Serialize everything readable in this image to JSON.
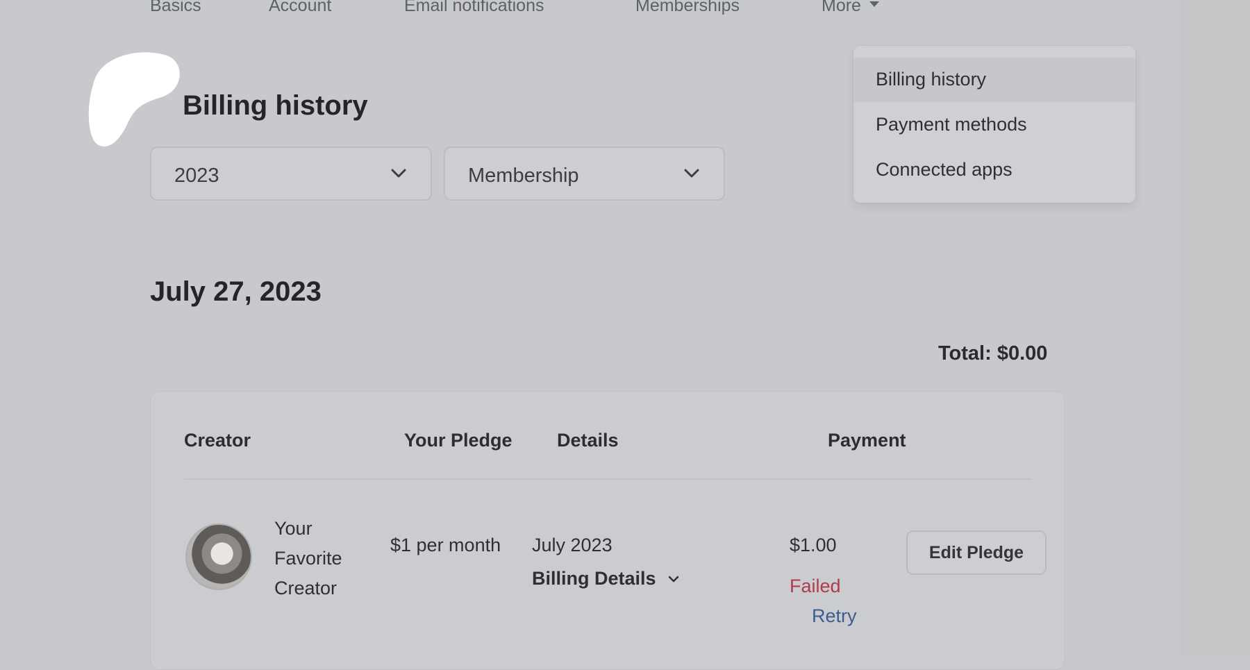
{
  "nav": {
    "tabs": [
      "Basics",
      "Account",
      "Email notifications",
      "Memberships"
    ],
    "more_label": "More"
  },
  "menu": {
    "items": [
      "Billing history",
      "Payment methods",
      "Connected apps"
    ],
    "active_index": 0
  },
  "page_title": "Billing history",
  "filters": {
    "year": "2023",
    "type": "Membership"
  },
  "billing_group": {
    "date": "July 27, 2023",
    "total": "Total: $0.00"
  },
  "table": {
    "headers": {
      "creator": "Creator",
      "pledge": "Your Pledge",
      "details": "Details",
      "payment": "Payment"
    },
    "row": {
      "creator_name": "Your Favorite Creator",
      "pledge": "$1 per month",
      "period": "July 2023",
      "billing_details_label": "Billing Details",
      "amount": "$1.00",
      "status": "Failed",
      "retry_label": "Retry",
      "edit_label": "Edit Pledge"
    }
  },
  "colors": {
    "failed": "#b23a4a",
    "retry": "#3e5b8f",
    "logo": "#ffffff"
  }
}
